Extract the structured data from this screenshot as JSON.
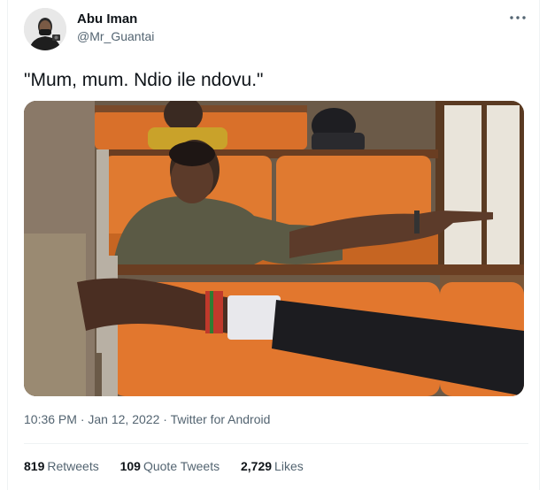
{
  "user": {
    "name": "Abu Iman",
    "handle": "@Mr_Guantai",
    "avatar_icon": "profile-photo"
  },
  "more_icon": "more-horizontal-icon",
  "tweet": {
    "text": "\"Mum, mum. Ndio ile ndovu.\"",
    "media_icon": "photo-man-pointing-in-train-carriage"
  },
  "meta": {
    "time": "10:36 PM",
    "sep1": " · ",
    "date": "Jan 12, 2022",
    "sep2": " · ",
    "source": "Twitter for Android"
  },
  "stats": {
    "retweets_count": "819",
    "retweets_label": "Retweets",
    "quotes_count": "109",
    "quotes_label": "Quote Tweets",
    "likes_count": "2,729",
    "likes_label": "Likes"
  },
  "colors": {
    "text_primary": "#0f1419",
    "text_secondary": "#536471",
    "divider": "#eff3f4",
    "seat_orange": "#e2772e"
  }
}
